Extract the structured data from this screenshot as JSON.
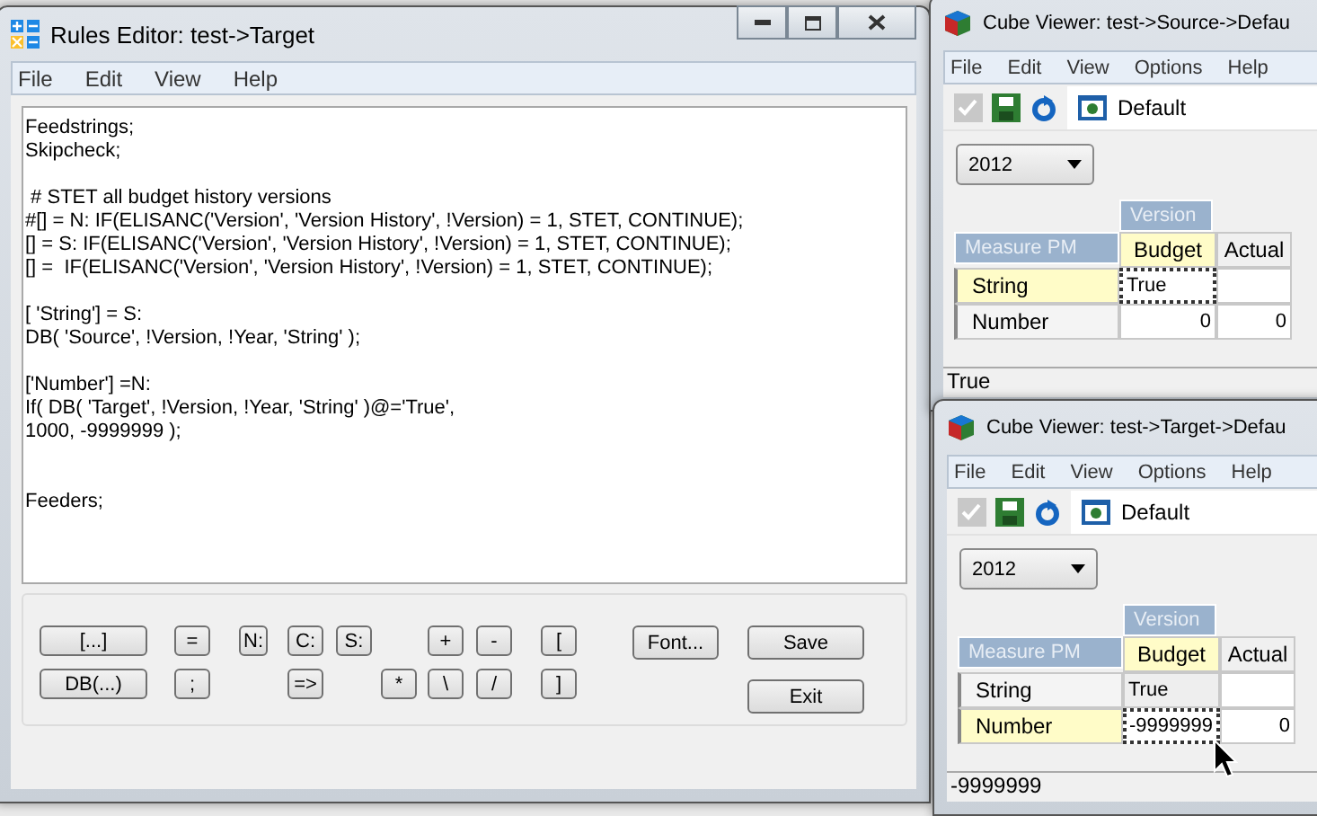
{
  "rules_editor": {
    "title": "Rules Editor:  test->Target",
    "menu": [
      "File",
      "Edit",
      "View",
      "Help"
    ],
    "code": "Feedstrings;\nSkipcheck;\n\n # STET all budget history versions\n#[] = N: IF(ELISANC('Version', 'Version History', !Version) = 1, STET, CONTINUE);\n[] = S: IF(ELISANC('Version', 'Version History', !Version) = 1, STET, CONTINUE);\n[] =  IF(ELISANC('Version', 'Version History', !Version) = 1, STET, CONTINUE);\n\n[ 'String'] = S:\nDB( 'Source', !Version, !Year, 'String' );\n\n['Number'] =N:\nIf( DB( 'Target', !Version, !Year, 'String' )@='True',\n1000, -9999999 );\n\n\nFeeders;",
    "buttons": [
      "[...]",
      "=",
      "N:",
      "C:",
      "S:",
      "+",
      "-",
      "[",
      "Font...",
      "Save",
      "DB(...)",
      ";",
      "=>",
      "*",
      "\\",
      "/",
      "]",
      "Exit"
    ]
  },
  "cube_viewers": [
    {
      "title": "Cube Viewer: test->Source->Defau",
      "menu": [
        "File",
        "Edit",
        "View",
        "Options",
        "Help"
      ],
      "view": "Default",
      "year": "2012",
      "column_dimension": "Version",
      "row_dimension": "Measure PM",
      "columns": [
        {
          "label": "Budget",
          "selected": true
        },
        {
          "label": "Actual",
          "selected": false
        }
      ],
      "rows": [
        {
          "label": "String",
          "selected": true,
          "cells": [
            {
              "value": "True",
              "selected": true,
              "kind": "text"
            },
            {
              "kind": "text",
              "selected": false
            }
          ]
        },
        {
          "label": "Number",
          "selected": false,
          "cells": [
            {
              "value": "0",
              "selected": false,
              "kind": "number"
            },
            {
              "value": "0",
              "selected": false,
              "kind": "number"
            }
          ]
        }
      ],
      "status": "True",
      "pointer": false
    },
    {
      "title": "Cube Viewer: test->Target->Defau",
      "menu": [
        "File",
        "Edit",
        "View",
        "Options",
        "Help"
      ],
      "view": "Default",
      "year": "2012",
      "column_dimension": "Version",
      "row_dimension": "Measure PM",
      "columns": [
        {
          "label": "Budget",
          "selected": true
        },
        {
          "label": "Actual",
          "selected": false
        }
      ],
      "rows": [
        {
          "label": "String",
          "selected": false,
          "cells": [
            {
              "value": "True",
              "selected": false,
              "kind": "text"
            },
            {
              "kind": "text",
              "selected": false
            }
          ]
        },
        {
          "label": "Number",
          "selected": true,
          "cells": [
            {
              "value": "-9999999",
              "selected": true,
              "kind": "number"
            },
            {
              "value": "0",
              "selected": false,
              "kind": "number"
            }
          ]
        }
      ],
      "status": "-9999999",
      "pointer": true
    }
  ]
}
